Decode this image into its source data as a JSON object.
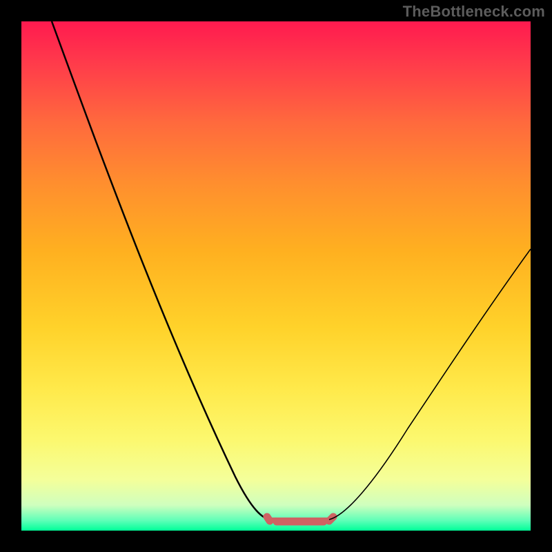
{
  "watermark": "TheBottleneck.com",
  "chart_data": {
    "type": "line",
    "title": "",
    "xlabel": "",
    "ylabel": "",
    "xlim": [
      0,
      100
    ],
    "ylim": [
      0,
      100
    ],
    "grid": false,
    "series": [
      {
        "name": "bottleneck-curve",
        "x": [
          0,
          10,
          20,
          30,
          40,
          48,
          52,
          55,
          60,
          65,
          70,
          80,
          90,
          100
        ],
        "y": [
          100,
          80,
          60,
          40,
          20,
          3,
          0,
          0,
          3,
          10,
          18,
          32,
          45,
          56
        ]
      }
    ],
    "annotations": [
      {
        "name": "optimal-range",
        "x_start": 48,
        "x_end": 60,
        "y": 2,
        "color": "#ce6363"
      }
    ],
    "background_gradient": {
      "top": "#ff1a4f",
      "mid": "#ffd22a",
      "bottom": "#00ff99"
    }
  }
}
